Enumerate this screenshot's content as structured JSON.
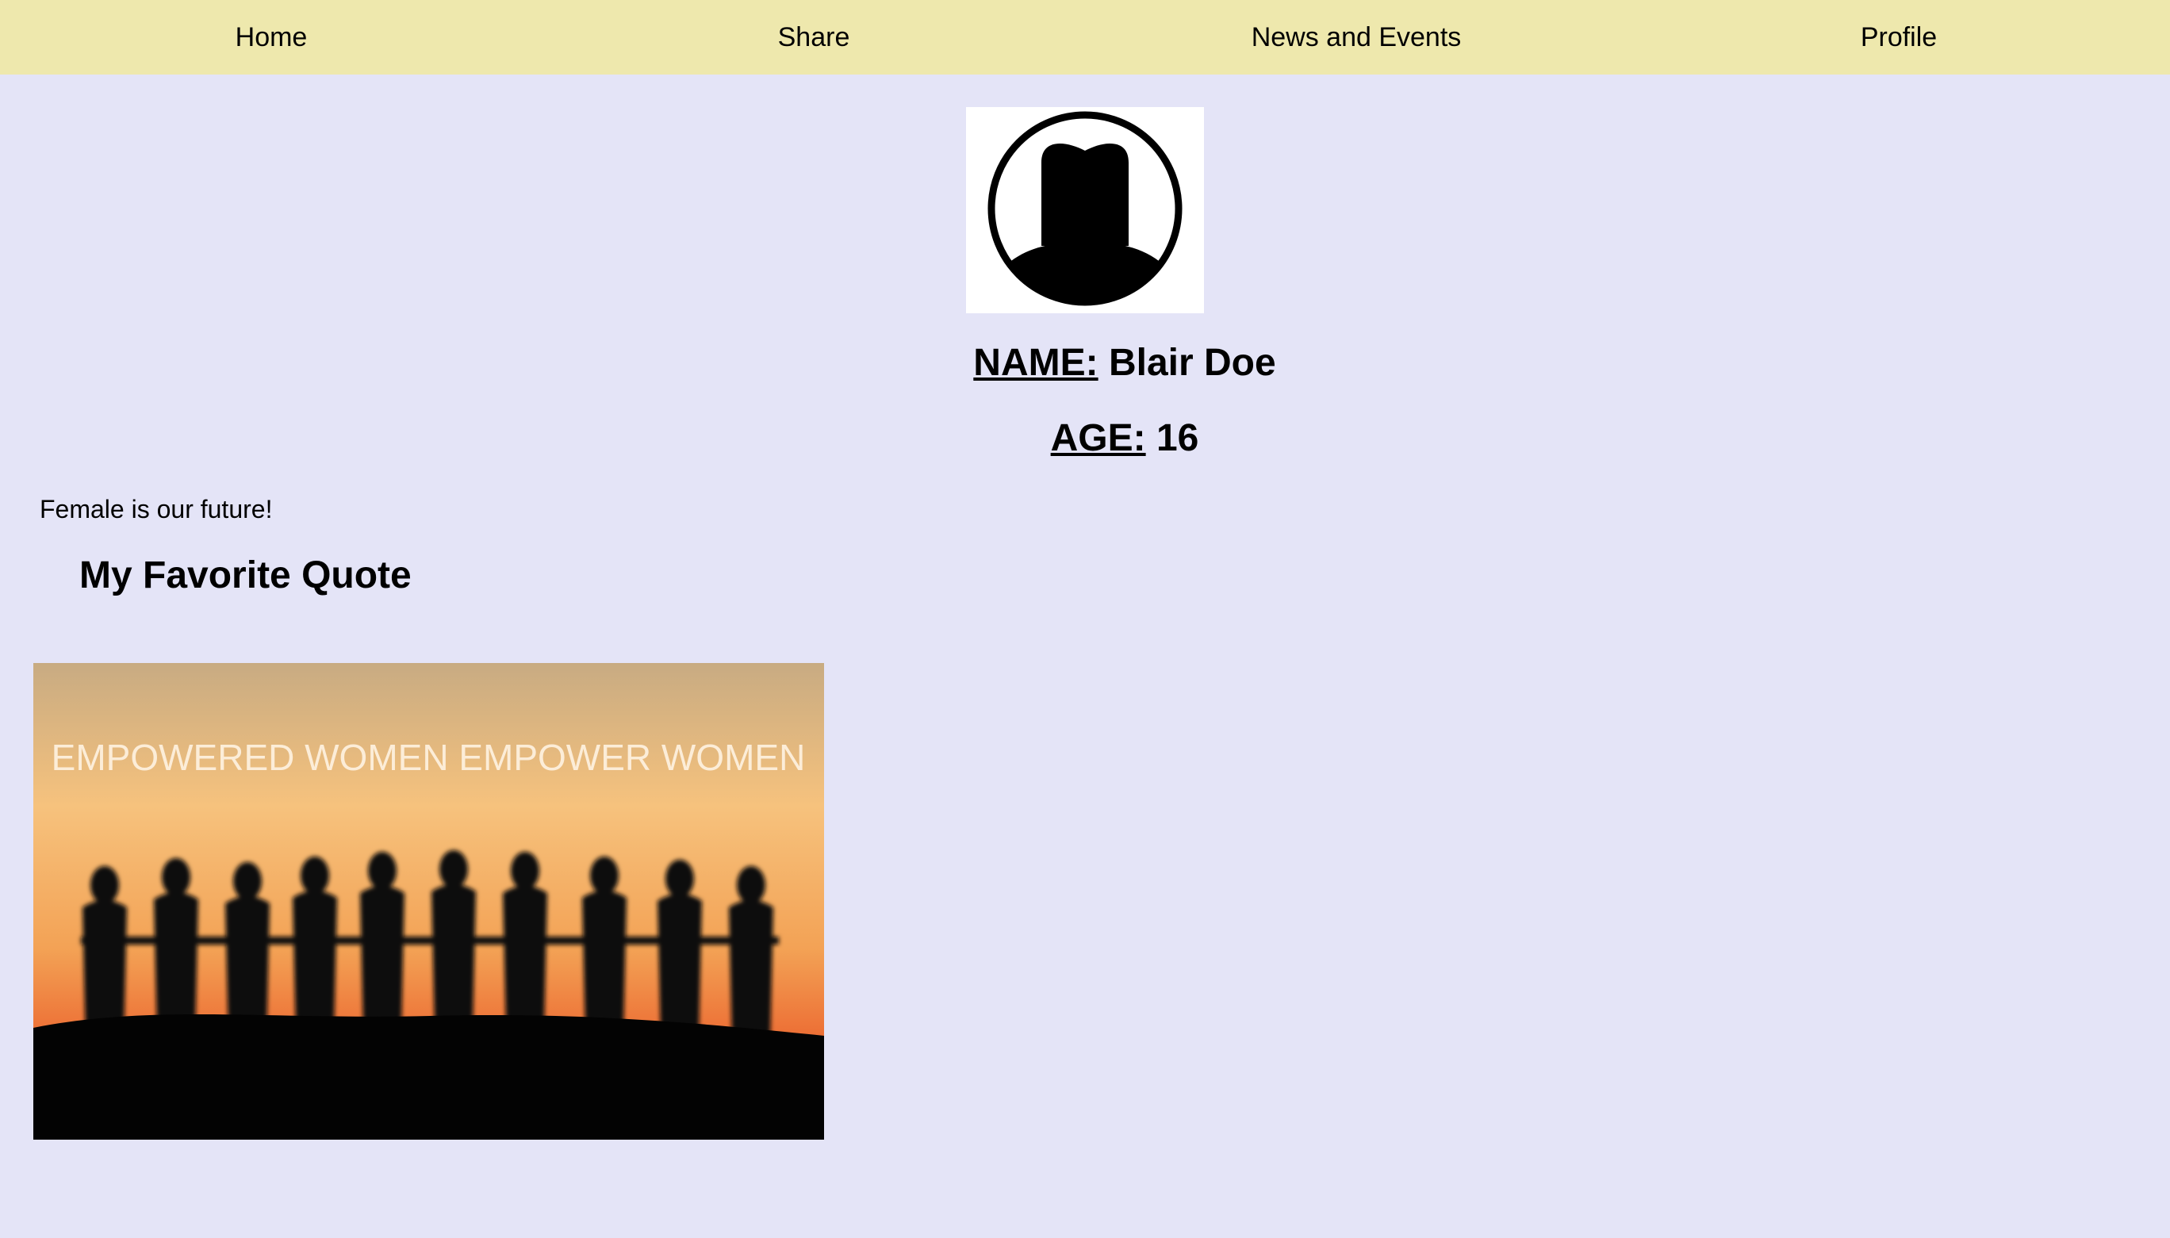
{
  "nav": {
    "items": [
      {
        "label": "Home"
      },
      {
        "label": "Share"
      },
      {
        "label": "News and Events"
      },
      {
        "label": "Profile"
      }
    ]
  },
  "profile": {
    "avatar_icon": "female-silhouette-icon",
    "name_label": "NAME:",
    "name_value": "Blair Doe",
    "age_label": "AGE:",
    "age_value": "16",
    "tagline": "Female is our future!"
  },
  "quote": {
    "heading": "My Favorite Quote",
    "image_text": "EMPOWERED WOMEN EMPOWER WOMEN"
  },
  "colors": {
    "nav_background": "#eee8ad",
    "page_background": "#e4e4f7"
  }
}
